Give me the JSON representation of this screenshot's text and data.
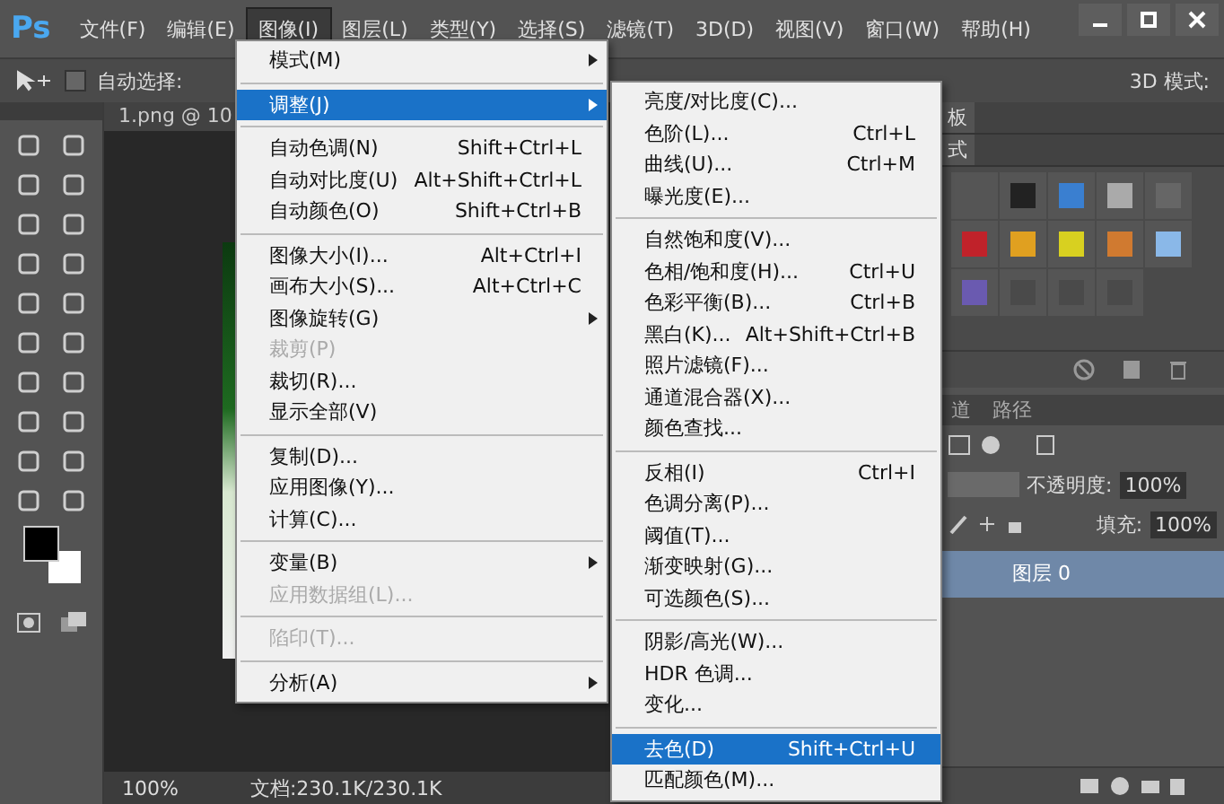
{
  "app_logo": "Ps",
  "menu_bar": [
    {
      "label": "文件(F)",
      "selected": false
    },
    {
      "label": "编辑(E)",
      "selected": false
    },
    {
      "label": "图像(I)",
      "selected": true
    },
    {
      "label": "图层(L)",
      "selected": false
    },
    {
      "label": "类型(Y)",
      "selected": false
    },
    {
      "label": "选择(S)",
      "selected": false
    },
    {
      "label": "滤镜(T)",
      "selected": false
    },
    {
      "label": "3D(D)",
      "selected": false
    },
    {
      "label": "视图(V)",
      "selected": false
    },
    {
      "label": "窗口(W)",
      "selected": false
    },
    {
      "label": "帮助(H)",
      "selected": false
    }
  ],
  "options_bar": {
    "auto_select": {
      "label": "自动选择:",
      "checked": false
    },
    "mode_3d_label": "3D 模式:"
  },
  "document": {
    "tab_title": "1.png @ 10",
    "zoom": "100%",
    "doc_size": "文档:230.1K/230.1K"
  },
  "image_menu": [
    {
      "kind": "item",
      "label": "模式(M)",
      "submenu": true,
      "disabled": false,
      "selected": false
    },
    {
      "kind": "separator"
    },
    {
      "kind": "item",
      "label": "调整(J)",
      "submenu": true,
      "disabled": false,
      "selected": true
    },
    {
      "kind": "separator"
    },
    {
      "kind": "item",
      "label": "自动色调(N)",
      "shortcut": "Shift+Ctrl+L",
      "disabled": false,
      "selected": false
    },
    {
      "kind": "item",
      "label": "自动对比度(U)",
      "shortcut": "Alt+Shift+Ctrl+L",
      "disabled": false,
      "selected": false
    },
    {
      "kind": "item",
      "label": "自动颜色(O)",
      "shortcut": "Shift+Ctrl+B",
      "disabled": false,
      "selected": false
    },
    {
      "kind": "separator"
    },
    {
      "kind": "item",
      "label": "图像大小(I)...",
      "shortcut": "Alt+Ctrl+I",
      "disabled": false,
      "selected": false
    },
    {
      "kind": "item",
      "label": "画布大小(S)...",
      "shortcut": "Alt+Ctrl+C",
      "disabled": false,
      "selected": false
    },
    {
      "kind": "item",
      "label": "图像旋转(G)",
      "submenu": true,
      "disabled": false,
      "selected": false
    },
    {
      "kind": "item",
      "label": "裁剪(P)",
      "disabled": true,
      "selected": false
    },
    {
      "kind": "item",
      "label": "裁切(R)...",
      "disabled": false,
      "selected": false
    },
    {
      "kind": "item",
      "label": "显示全部(V)",
      "disabled": false,
      "selected": false
    },
    {
      "kind": "separator"
    },
    {
      "kind": "item",
      "label": "复制(D)...",
      "disabled": false,
      "selected": false
    },
    {
      "kind": "item",
      "label": "应用图像(Y)...",
      "disabled": false,
      "selected": false
    },
    {
      "kind": "item",
      "label": "计算(C)...",
      "disabled": false,
      "selected": false
    },
    {
      "kind": "separator"
    },
    {
      "kind": "item",
      "label": "变量(B)",
      "submenu": true,
      "disabled": false,
      "selected": false
    },
    {
      "kind": "item",
      "label": "应用数据组(L)...",
      "disabled": true,
      "selected": false
    },
    {
      "kind": "separator"
    },
    {
      "kind": "item",
      "label": "陷印(T)...",
      "disabled": true,
      "selected": false
    },
    {
      "kind": "separator"
    },
    {
      "kind": "item",
      "label": "分析(A)",
      "submenu": true,
      "disabled": false,
      "selected": false
    }
  ],
  "adjustments_menu": [
    {
      "kind": "item",
      "label": "亮度/对比度(C)...",
      "disabled": false,
      "selected": false
    },
    {
      "kind": "item",
      "label": "色阶(L)...",
      "shortcut": "Ctrl+L",
      "disabled": false,
      "selected": false
    },
    {
      "kind": "item",
      "label": "曲线(U)...",
      "shortcut": "Ctrl+M",
      "disabled": false,
      "selected": false
    },
    {
      "kind": "item",
      "label": "曝光度(E)...",
      "disabled": false,
      "selected": false
    },
    {
      "kind": "separator"
    },
    {
      "kind": "item",
      "label": "自然饱和度(V)...",
      "disabled": false,
      "selected": false
    },
    {
      "kind": "item",
      "label": "色相/饱和度(H)...",
      "shortcut": "Ctrl+U",
      "disabled": false,
      "selected": false
    },
    {
      "kind": "item",
      "label": "色彩平衡(B)...",
      "shortcut": "Ctrl+B",
      "disabled": false,
      "selected": false
    },
    {
      "kind": "item",
      "label": "黑白(K)...",
      "shortcut": "Alt+Shift+Ctrl+B",
      "disabled": false,
      "selected": false
    },
    {
      "kind": "item",
      "label": "照片滤镜(F)...",
      "disabled": false,
      "selected": false
    },
    {
      "kind": "item",
      "label": "通道混合器(X)...",
      "disabled": false,
      "selected": false
    },
    {
      "kind": "item",
      "label": "颜色查找...",
      "disabled": false,
      "selected": false
    },
    {
      "kind": "separator"
    },
    {
      "kind": "item",
      "label": "反相(I)",
      "shortcut": "Ctrl+I",
      "disabled": false,
      "selected": false
    },
    {
      "kind": "item",
      "label": "色调分离(P)...",
      "disabled": false,
      "selected": false
    },
    {
      "kind": "item",
      "label": "阈值(T)...",
      "disabled": false,
      "selected": false
    },
    {
      "kind": "item",
      "label": "渐变映射(G)...",
      "disabled": false,
      "selected": false
    },
    {
      "kind": "item",
      "label": "可选颜色(S)...",
      "disabled": false,
      "selected": false
    },
    {
      "kind": "separator"
    },
    {
      "kind": "item",
      "label": "阴影/高光(W)...",
      "disabled": false,
      "selected": false
    },
    {
      "kind": "item",
      "label": "HDR 色调...",
      "disabled": false,
      "selected": false
    },
    {
      "kind": "item",
      "label": "变化...",
      "disabled": false,
      "selected": false
    },
    {
      "kind": "separator"
    },
    {
      "kind": "item",
      "label": "去色(D)",
      "shortcut": "Shift+Ctrl+U",
      "disabled": false,
      "selected": true
    },
    {
      "kind": "item",
      "label": "匹配颜色(M)...",
      "disabled": false,
      "selected": false
    }
  ],
  "right_panel": {
    "top_tabs": [
      "板",
      "式"
    ],
    "layer_tabs": [
      {
        "label": "道",
        "selected": false
      },
      {
        "label": "路径",
        "selected": false
      }
    ],
    "opacity_label": "不透明度:",
    "opacity": "100%",
    "fill_label": "填充:",
    "fill": "100%",
    "layers": [
      {
        "name": "图层 0",
        "selected": true
      }
    ]
  }
}
